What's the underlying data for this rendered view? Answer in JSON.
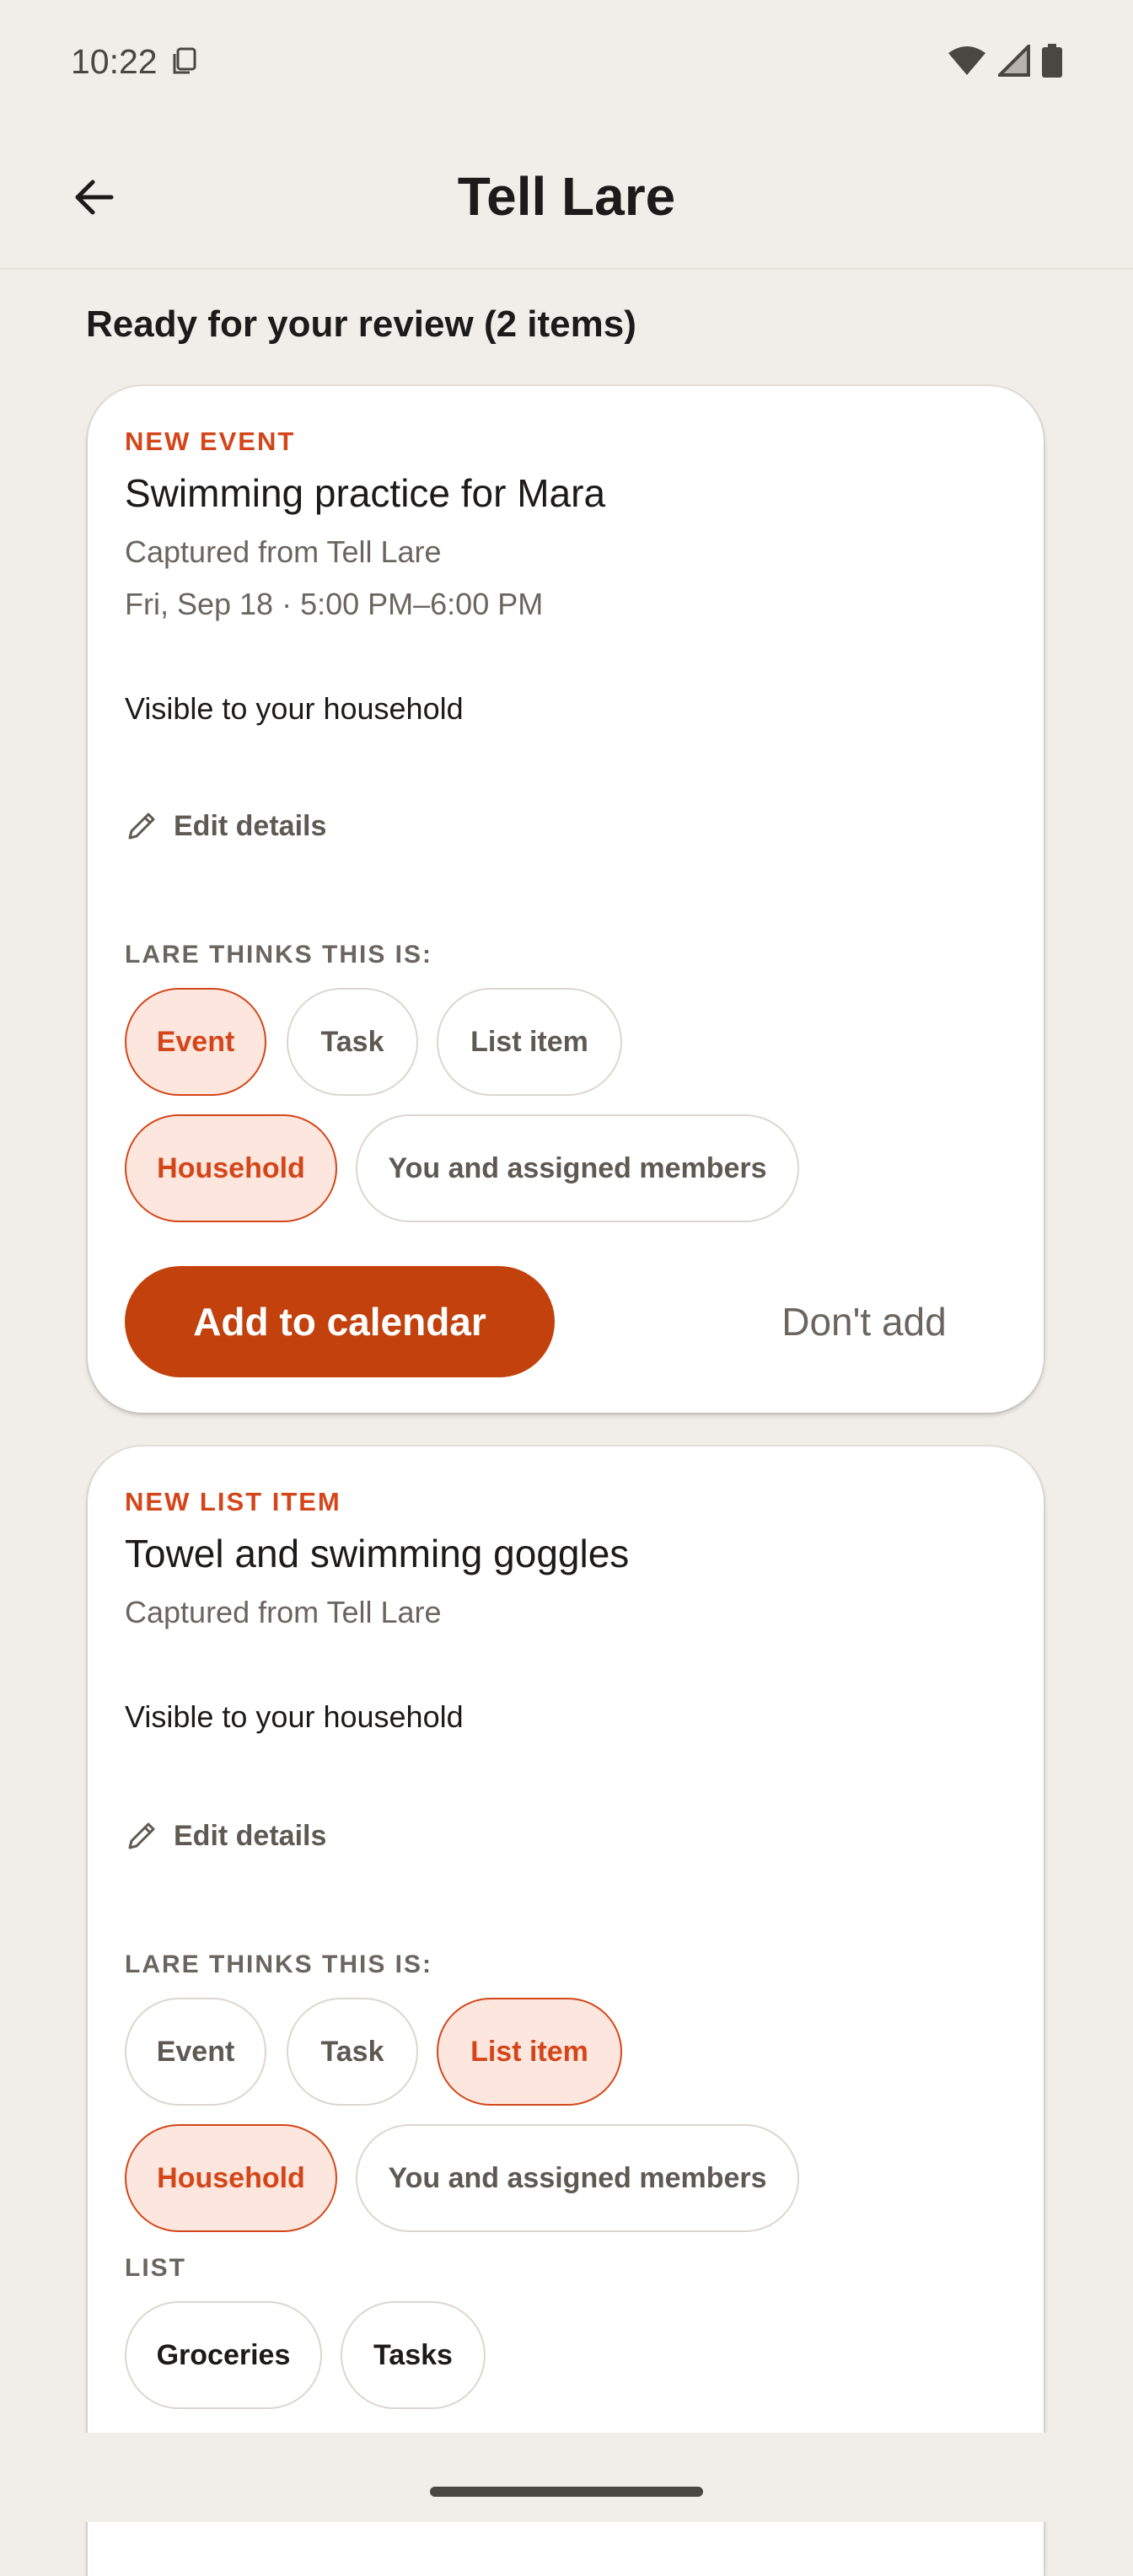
{
  "status": {
    "time": "10:22"
  },
  "header": {
    "title": "Tell Lare"
  },
  "review": {
    "heading": "Ready for your review (2 items)"
  },
  "cards": [
    {
      "kind": "NEW EVENT",
      "title": "Swimming practice for Mara",
      "source": "Captured from Tell Lare",
      "when": "Fri, Sep 18 · 5:00 PM–6:00 PM",
      "visibility": "Visible to your household",
      "edit_label": "Edit details",
      "thinks_label": "LARE THINKS THIS IS:",
      "types": [
        "Event",
        "Task",
        "List item"
      ],
      "selected_type": "Event",
      "audiences": [
        "Household",
        "You and assigned members"
      ],
      "selected_audience": "Household",
      "primary_action": "Add to calendar",
      "secondary_action": "Don't add"
    },
    {
      "kind": "NEW LIST ITEM",
      "title": "Towel and swimming goggles",
      "source": "Captured from Tell Lare",
      "visibility": "Visible to your household",
      "edit_label": "Edit details",
      "thinks_label": "LARE THINKS THIS IS:",
      "types": [
        "Event",
        "Task",
        "List item"
      ],
      "selected_type": "List item",
      "audiences": [
        "Household",
        "You and assigned members"
      ],
      "selected_audience": "Household",
      "list_label": "LIST",
      "lists": [
        "Groceries",
        "Tasks"
      ]
    }
  ],
  "colors": {
    "accent": "#d4461a",
    "primary_button": "#c2410c",
    "background": "#f1ede8"
  },
  "icons": {
    "back": "arrow-left-icon",
    "edit": "pencil-icon",
    "wifi": "wifi-icon",
    "signal": "signal-icon",
    "battery": "battery-icon"
  }
}
